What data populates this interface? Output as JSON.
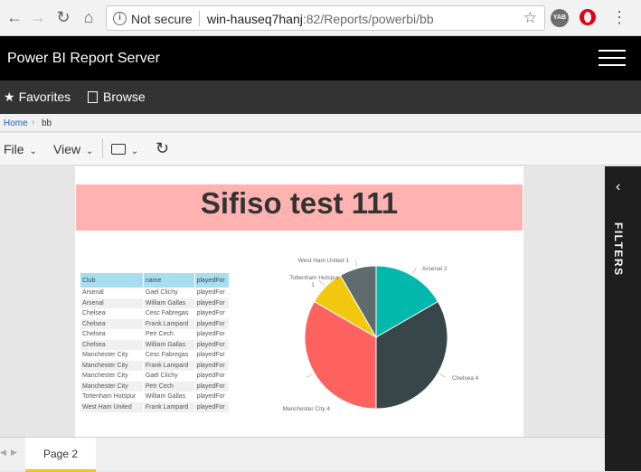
{
  "browser": {
    "security_label": "Not secure",
    "url_host": "win-hauseq7hanj",
    "url_rest": ":82/Reports/powerbi/bb",
    "ext_yab": "YAB"
  },
  "header": {
    "title": "Power BI Report Server"
  },
  "nav": {
    "favorites": "Favorites",
    "browse": "Browse"
  },
  "breadcrumb": {
    "home": "Home",
    "current": "bb"
  },
  "toolbar": {
    "file": "File",
    "view": "View"
  },
  "report": {
    "title": "Sifiso test 111",
    "table": {
      "columns": [
        "Club",
        "name",
        "playedFor"
      ],
      "rows": [
        [
          "Arsenal",
          "Gael Clichy",
          "playedFor"
        ],
        [
          "Arsenal",
          "William Gallas",
          "playedFor"
        ],
        [
          "Chelsea",
          "Cesc Fabregas",
          "playedFor"
        ],
        [
          "Chelsea",
          "Frank Lampard",
          "playedFor"
        ],
        [
          "Chelsea",
          "Petr Cech",
          "playedFor"
        ],
        [
          "Chelsea",
          "William Gallas",
          "playedFor"
        ],
        [
          "Manchester City",
          "Cesc Fabregas",
          "playedFor"
        ],
        [
          "Manchester City",
          "Frank Lampard",
          "playedFor"
        ],
        [
          "Manchester City",
          "Gael Clichy",
          "playedFor"
        ],
        [
          "Manchester City",
          "Petr Cech",
          "playedFor"
        ],
        [
          "Tottenham Hotspur",
          "William Gallas",
          "playedFor"
        ],
        [
          "West Ham United",
          "Frank Lampard",
          "playedFor"
        ]
      ]
    }
  },
  "chart_data": {
    "type": "pie",
    "slices": [
      {
        "label": "Arsenal",
        "value": 2,
        "color": "#01b8aa"
      },
      {
        "label": "Chelsea",
        "value": 4,
        "color": "#374649"
      },
      {
        "label": "Manchester City",
        "value": 4,
        "color": "#fd625e"
      },
      {
        "label": "Tottenham Hotspur",
        "value": 1,
        "color": "#f2c80f"
      },
      {
        "label": "West Ham United",
        "value": 1,
        "color": "#5f6b6d"
      }
    ],
    "data_labels": [
      "Arsenal 2",
      "Chelsea 4",
      "Manchester City 4",
      "Tottenham Hotspur",
      "1",
      "West Ham United 1"
    ]
  },
  "filters": {
    "label": "FILTERS"
  },
  "tabs": {
    "page": "Page 2"
  }
}
